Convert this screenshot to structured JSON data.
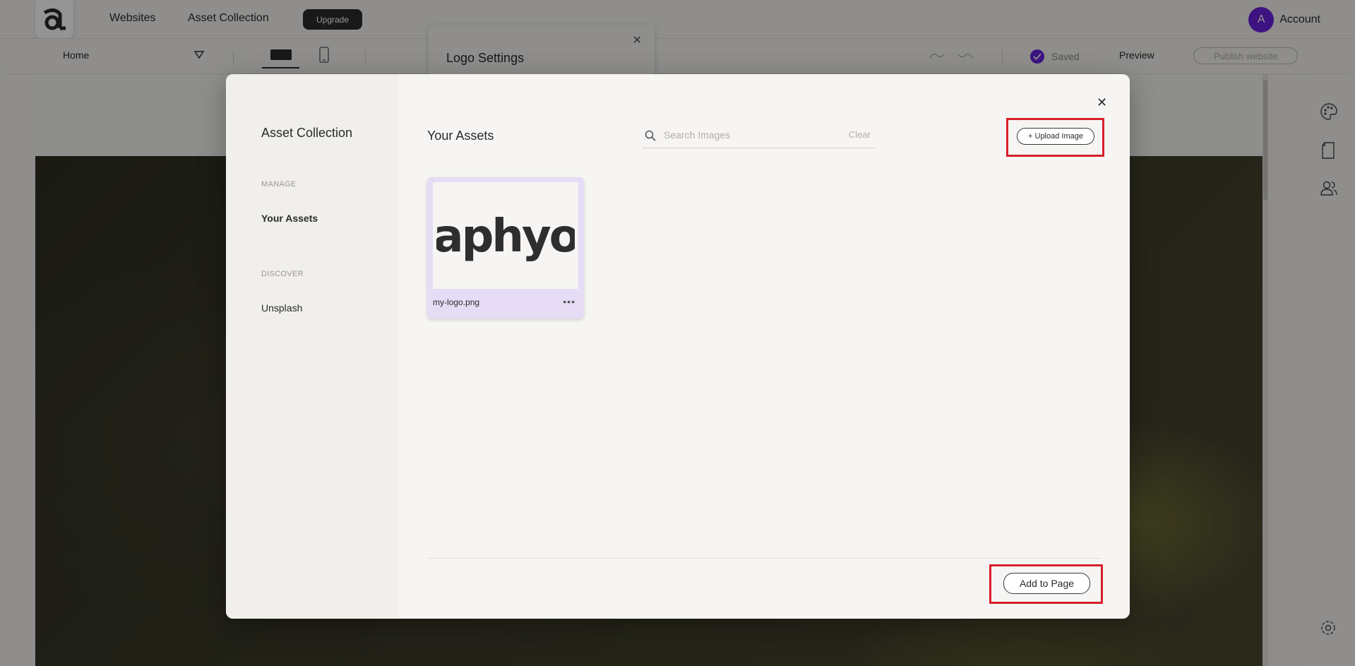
{
  "topnav": {
    "logo_icon": "brand-a-logo",
    "links": [
      "Websites",
      "Asset Collection"
    ],
    "upgrade_label": "Upgrade",
    "account_initial": "A",
    "account_label": "Account"
  },
  "toolbar": {
    "page_label": "Home",
    "saved_label": "Saved",
    "preview_label": "Preview",
    "publish_label": "Publish website"
  },
  "logo_settings": {
    "title": "Logo Settings"
  },
  "modal": {
    "sidebar": {
      "title": "Asset Collection",
      "sections": [
        {
          "label": "MANAGE",
          "items": [
            "Your Assets"
          ]
        },
        {
          "label": "DISCOVER",
          "items": [
            "Unsplash"
          ]
        }
      ]
    },
    "main": {
      "title": "Your Assets",
      "search_placeholder": "Search Images",
      "clear_label": "Clear",
      "upload_label": "+ Upload Image",
      "assets": [
        {
          "name": "my-logo.png",
          "preview_text": "aphyo"
        }
      ],
      "add_label": "Add to Page"
    }
  },
  "colors": {
    "accent": "#6a22e0",
    "highlight": "#d8202a",
    "card_selected": "#e6dcf5"
  }
}
